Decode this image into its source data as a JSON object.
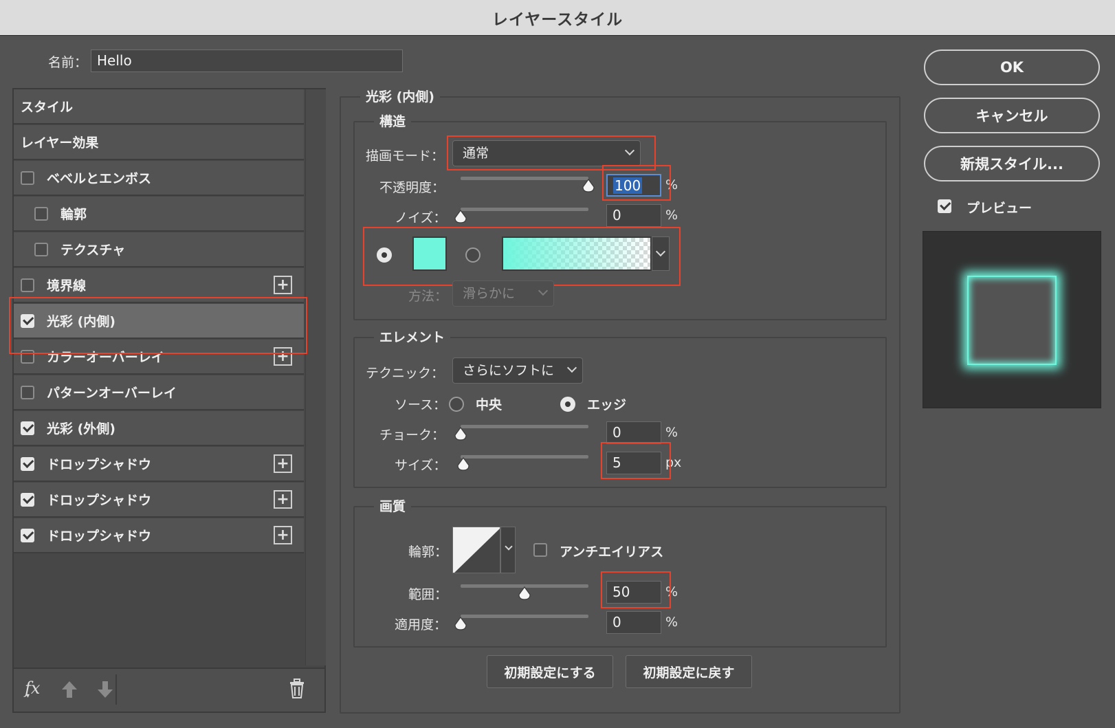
{
  "window": {
    "title": "レイヤースタイル"
  },
  "name_field": {
    "label": "名前：",
    "value": "Hello"
  },
  "style_list": {
    "items": [
      {
        "label": "スタイル",
        "checkbox": null,
        "plus": false
      },
      {
        "label": "レイヤー効果",
        "checkbox": null,
        "plus": false
      },
      {
        "label": "ベベルとエンボス",
        "checkbox": false,
        "plus": false
      },
      {
        "label": "輪郭",
        "checkbox": false,
        "plus": false,
        "indent": true
      },
      {
        "label": "テクスチャ",
        "checkbox": false,
        "plus": false,
        "indent": true
      },
      {
        "label": "境界線",
        "checkbox": false,
        "plus": true
      },
      {
        "label": "光彩 (内側)",
        "checkbox": true,
        "plus": false,
        "selected": true
      },
      {
        "label": "カラーオーバーレイ",
        "checkbox": false,
        "plus": true
      },
      {
        "label": "パターンオーバーレイ",
        "checkbox": false,
        "plus": false
      },
      {
        "label": "光彩 (外側)",
        "checkbox": true,
        "plus": false
      },
      {
        "label": "ドロップシャドウ",
        "checkbox": true,
        "plus": true
      },
      {
        "label": "ドロップシャドウ",
        "checkbox": true,
        "plus": true
      },
      {
        "label": "ドロップシャドウ",
        "checkbox": true,
        "plus": true
      }
    ],
    "footer_fx": "fx"
  },
  "panel": {
    "title": "光彩 (内側)",
    "structure": {
      "title": "構造",
      "blend_mode_label": "描画モード：",
      "blend_mode_value": "通常",
      "opacity_label": "不透明度：",
      "opacity_value": "100",
      "opacity_pct": 100,
      "noise_label": "ノイズ：",
      "noise_value": "0",
      "noise_pct": 0,
      "percent": "%",
      "method_label": "方法：",
      "method_value": "滑らかに",
      "color": "#6ff5dc"
    },
    "elements": {
      "title": "エレメント",
      "technique_label": "テクニック：",
      "technique_value": "さらにソフトに",
      "source_label": "ソース：",
      "source_center": "中央",
      "source_edge": "エッジ",
      "choke_label": "チョーク：",
      "choke_value": "0",
      "choke_pct": 0,
      "size_label": "サイズ：",
      "size_value": "5",
      "size_pct": 2,
      "percent": "%",
      "px": "px"
    },
    "quality": {
      "title": "画質",
      "contour_label": "輪郭：",
      "antialias_label": "アンチエイリアス",
      "range_label": "範囲：",
      "range_value": "50",
      "range_pct": 50,
      "jitter_label": "適用度：",
      "jitter_value": "0",
      "jitter_pct": 0,
      "percent": "%"
    },
    "buttons": {
      "make_default": "初期設定にする",
      "reset_default": "初期設定に戻す"
    }
  },
  "right": {
    "ok": "OK",
    "cancel": "キャンセル",
    "new_style": "新規スタイル...",
    "preview_label": "プレビュー",
    "glow_color": "#6ff5dc"
  }
}
